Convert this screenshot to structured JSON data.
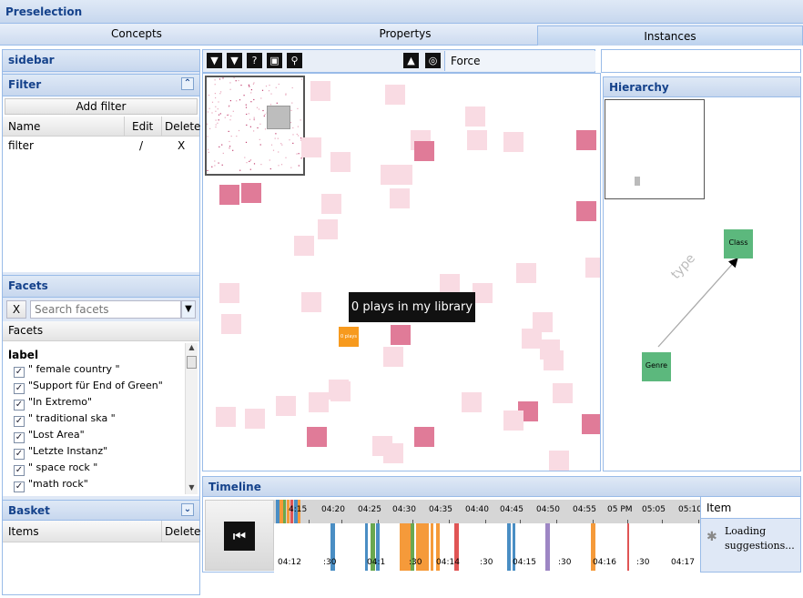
{
  "app": {
    "title": "Preselection"
  },
  "tabs": [
    {
      "label": "Concepts"
    },
    {
      "label": "Propertys"
    },
    {
      "label": "Instances"
    }
  ],
  "sidebar": {
    "title": "sidebar"
  },
  "filter": {
    "title": "Filter",
    "add_label": "Add filter",
    "columns": [
      "Name",
      "Edit",
      "Delete"
    ],
    "rows": [
      {
        "name": "filter",
        "edit": "/",
        "delete": "X"
      }
    ]
  },
  "facets": {
    "title": "Facets",
    "clear_label": "X",
    "search_placeholder": "Search facets",
    "header": "Facets",
    "group_label": "label",
    "items": [
      {
        "label": "\" female country \"",
        "checked": true
      },
      {
        "label": "\"Support für End of Green\"",
        "checked": true
      },
      {
        "label": "\"In Extremo\"",
        "checked": true
      },
      {
        "label": "\" traditional ska \"",
        "checked": true
      },
      {
        "label": "\"Lost Area\"",
        "checked": true
      },
      {
        "label": "\"Letzte Instanz\"",
        "checked": true
      },
      {
        "label": "\" space rock \"",
        "checked": true
      },
      {
        "label": "\"math rock\"",
        "checked": true
      }
    ]
  },
  "basket": {
    "title": "Basket",
    "columns": [
      "Items",
      "Delete"
    ]
  },
  "toolbar": {
    "layout_label": "Force"
  },
  "graph": {
    "tooltip": "0 plays in my library",
    "highlight_label": "0 plays in"
  },
  "hierarchy": {
    "title": "Hierarchy",
    "nodes": [
      {
        "label": "Class"
      },
      {
        "label": "Genre"
      }
    ],
    "edge_label": "type"
  },
  "timeline": {
    "title": "Timeline",
    "top_ticks": [
      "4:15",
      "04:20",
      "04:25",
      "04:30",
      "04:35",
      "04:40",
      "04:45",
      "04:50",
      "04:55",
      "05 PM",
      "05:05",
      "05:10"
    ],
    "bottom_ticks": [
      "04:12",
      ":30",
      "04:1",
      ":30",
      "04:14",
      ":30",
      "04:15",
      ":30",
      "04:16",
      ":30",
      "04:17"
    ],
    "item_header": "Item",
    "loading_text": "Loading suggestions...",
    "colors": {
      "blue": "#4a8ec4",
      "green": "#6aa84f",
      "orange": "#f59a3a",
      "red": "#e05555",
      "purple": "#9d86c4"
    }
  }
}
